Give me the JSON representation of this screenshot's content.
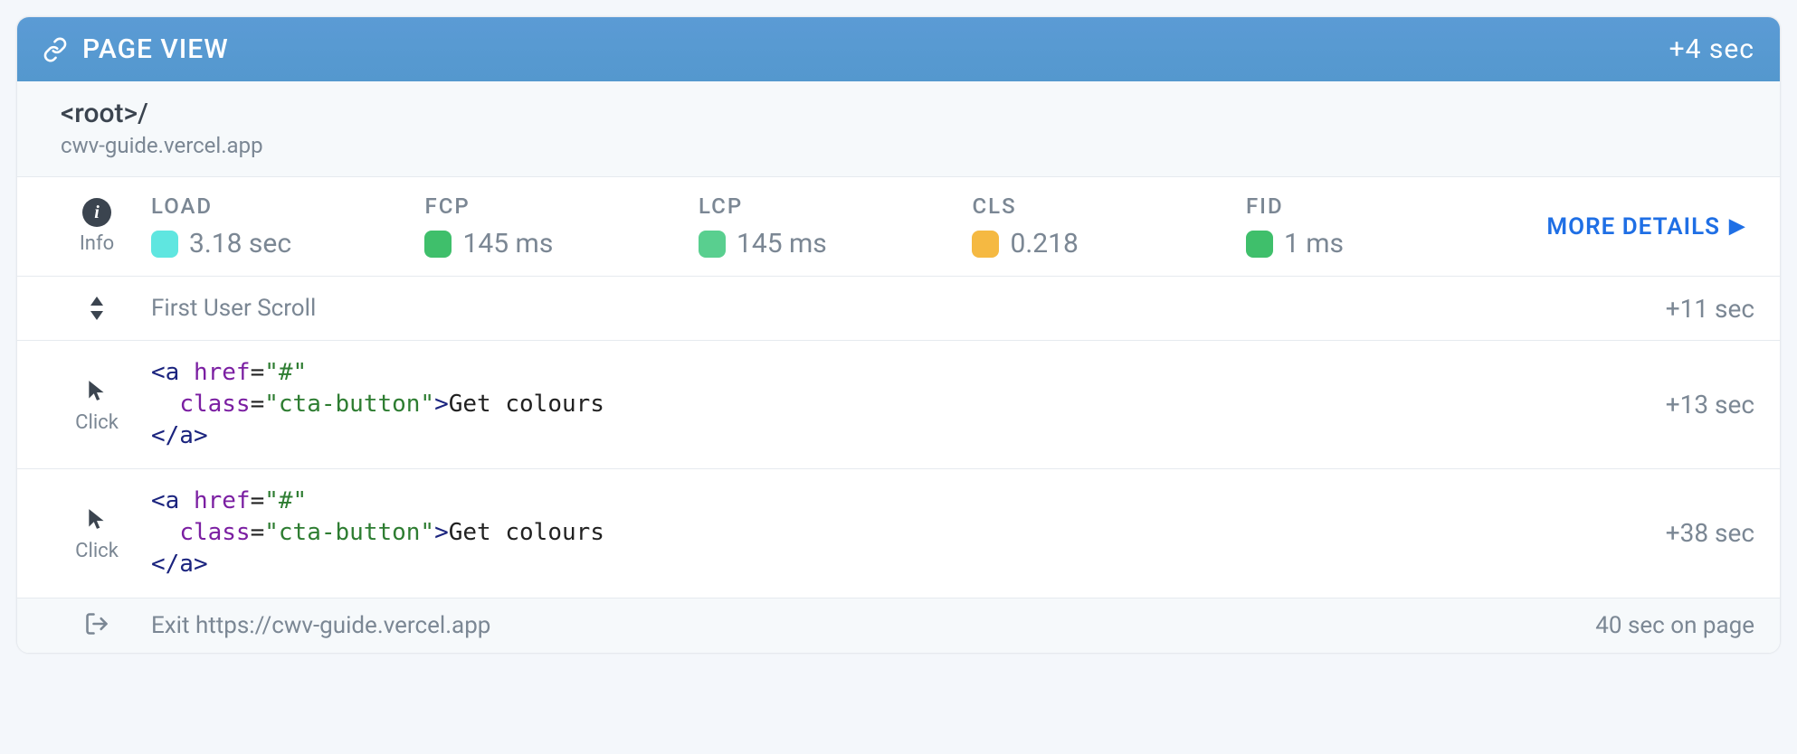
{
  "header": {
    "title": "PAGE VIEW",
    "timestamp": "+4 sec"
  },
  "page": {
    "path": "<root>/",
    "domain": "cwv-guide.vercel.app"
  },
  "info_label": "Info",
  "metrics": {
    "load": {
      "label": "LOAD",
      "value": "3.18 sec",
      "color": "#5fe6e0"
    },
    "fcp": {
      "label": "FCP",
      "value": "145 ms",
      "color": "#3fbf6b"
    },
    "lcp": {
      "label": "LCP",
      "value": "145 ms",
      "color": "#59cf8f"
    },
    "cls": {
      "label": "CLS",
      "value": "0.218",
      "color": "#f5b942"
    },
    "fid": {
      "label": "FID",
      "value": "1 ms",
      "color": "#3fbf6b"
    }
  },
  "more_details": "MORE DETAILS",
  "events": {
    "scroll": {
      "label": "First User Scroll",
      "time": "+11 sec"
    },
    "click1": {
      "icon_label": "Click",
      "time": "+13 sec",
      "code": {
        "open_tag": "<a",
        "sp": " ",
        "href_attr": "href",
        "eq": "=",
        "href_val": "\"#\"",
        "indent": "\n  ",
        "class_attr": "class",
        "class_val": "\"cta-button\"",
        "gt": ">",
        "text": "Get colours",
        "nl": "\n",
        "close_tag": "</a>"
      }
    },
    "click2": {
      "icon_label": "Click",
      "time": "+38 sec",
      "code": {
        "open_tag": "<a",
        "sp": " ",
        "href_attr": "href",
        "eq": "=",
        "href_val": "\"#\"",
        "indent": "\n  ",
        "class_attr": "class",
        "class_val": "\"cta-button\"",
        "gt": ">",
        "text": "Get colours",
        "nl": "\n",
        "close_tag": "</a>"
      }
    }
  },
  "footer": {
    "exit_text": "Exit https://cwv-guide.vercel.app",
    "time_on_page": "40 sec on page"
  }
}
